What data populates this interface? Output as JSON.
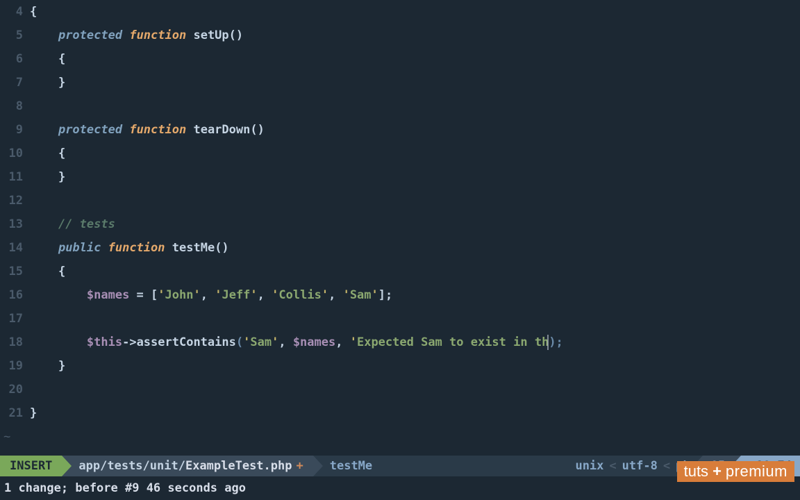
{
  "gutter": {
    "start": 4,
    "end": 21
  },
  "code": {
    "l4": "{",
    "l5": {
      "access": "protected",
      "func": "function",
      "name": "setUp",
      "pp": "()"
    },
    "l6": "{",
    "l7": "}",
    "l9": {
      "access": "protected",
      "func": "function",
      "name": "tearDown",
      "pp": "()"
    },
    "l10": "{",
    "l11": "}",
    "l13": "// tests",
    "l14": {
      "access": "public",
      "func": "function",
      "name": "testMe",
      "pp": "()"
    },
    "l15": "{",
    "l16": {
      "var": "$names",
      "eq": " = ",
      "lb": "[",
      "s1": "John",
      "s2": "Jeff",
      "s3": "Collis",
      "s4": "Sam",
      "rb": "];"
    },
    "l18": {
      "this": "$this",
      "arrow": "->",
      "method": "assertContains",
      "lp": "(",
      "arg1": "Sam",
      "arg2": "$names",
      "msg": "Expected Sam to exist in th",
      "tail": ");"
    },
    "l19": "}",
    "l21": "}"
  },
  "status": {
    "mode": "INSERT",
    "path_prefix": "app/tests/unit/",
    "path_bold": "ExampleTest.php",
    "modified": "+",
    "func": "testMe",
    "format": "unix",
    "encoding": "utf-8",
    "filetype": "php",
    "percent": "95%",
    "line": "18",
    "col": "74"
  },
  "message": "1 change; before #9  46 seconds ago",
  "watermark": {
    "brand": "tuts",
    "plus": "+",
    "prem": "premium"
  }
}
